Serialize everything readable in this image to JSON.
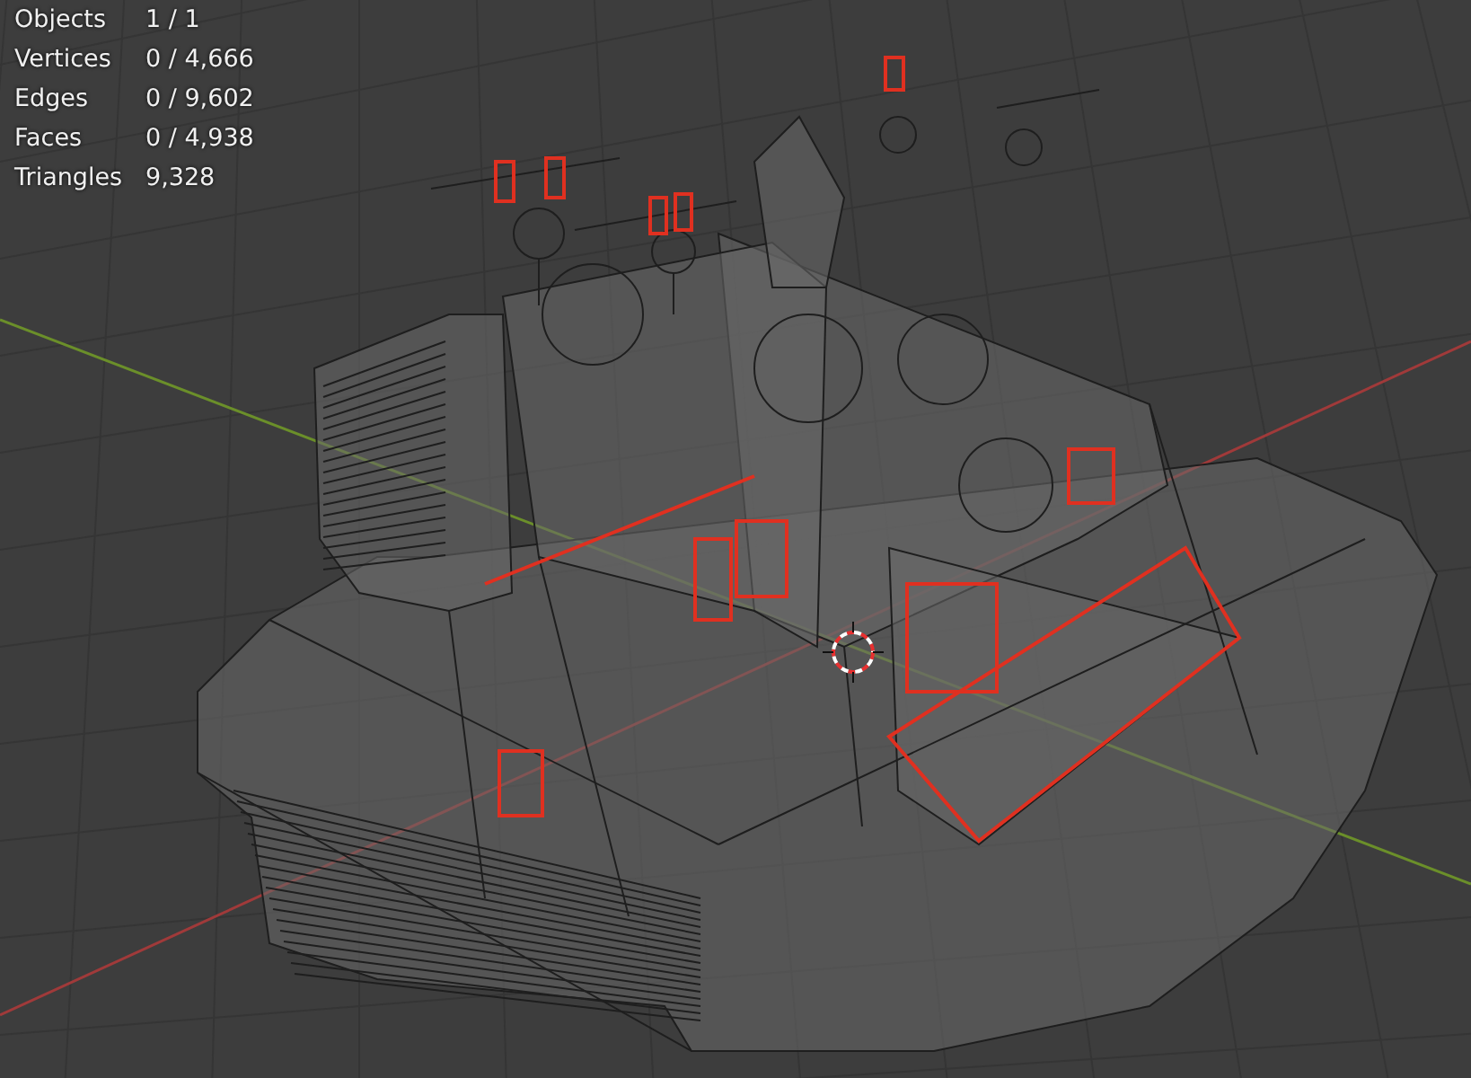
{
  "stats": [
    {
      "label": "Objects",
      "value": "1 / 1"
    },
    {
      "label": "Vertices",
      "value": "0 / 4,666"
    },
    {
      "label": "Edges",
      "value": "0 / 9,602"
    },
    {
      "label": "Faces",
      "value": "0 / 4,938"
    },
    {
      "label": "Triangles",
      "value": "9,328"
    }
  ]
}
